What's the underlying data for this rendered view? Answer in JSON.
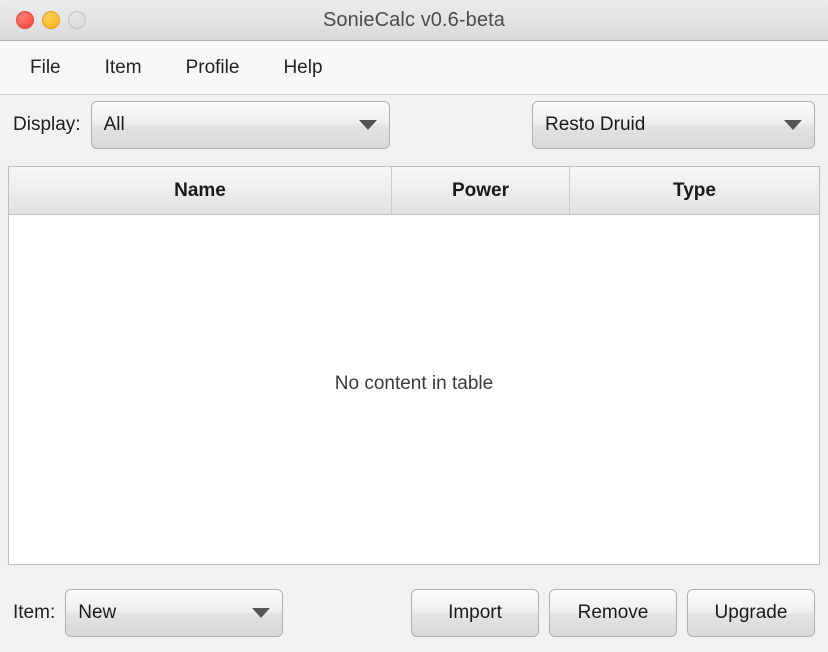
{
  "window": {
    "title": "SonieCalc v0.6-beta",
    "traffic_lights": [
      {
        "name": "close",
        "color": "#f9534b"
      },
      {
        "name": "minimize",
        "color": "#f9bb26"
      },
      {
        "name": "zoom",
        "color": "#dcdcdc"
      }
    ]
  },
  "menubar": {
    "items": [
      {
        "label": "File"
      },
      {
        "label": "Item"
      },
      {
        "label": "Profile"
      },
      {
        "label": "Help"
      }
    ]
  },
  "toolbar_top": {
    "display_label": "Display:",
    "display_value": "All",
    "profile_value": "Resto Druid",
    "arrow_icon": "chevron-down-icon"
  },
  "table": {
    "columns": [
      {
        "label": "Name"
      },
      {
        "label": "Power"
      },
      {
        "label": "Type"
      }
    ],
    "rows": [],
    "empty_message": "No content in table"
  },
  "toolbar_bottom": {
    "item_label": "Item:",
    "item_value": "New",
    "buttons": [
      {
        "label": "Import"
      },
      {
        "label": "Remove"
      },
      {
        "label": "Upgrade"
      }
    ]
  },
  "colors": {
    "window_bg": "#f2f2f2",
    "titlebar_bg": "#e4e4e4",
    "menubar_bg": "#f7f7f7",
    "table_bg": "#ffffff",
    "text": "#1b1b1b"
  }
}
